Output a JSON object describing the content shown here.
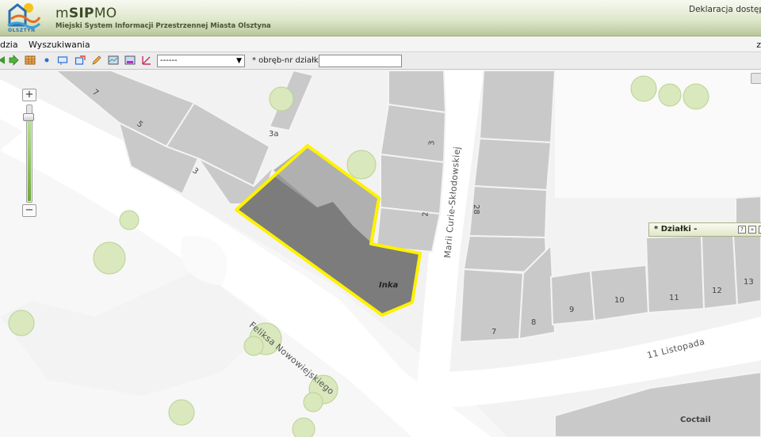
{
  "header": {
    "logo_caption": "OLSZTYN",
    "title_prefix": "m",
    "title_bold": "SIP",
    "title_suffix": "MO",
    "subtitle": "Miejski System Informacji Przestrzennej Miasta Olsztyna",
    "access_link": "Deklaracja dostęp"
  },
  "menu": {
    "items": [
      "dzia",
      "Wyszukiwania"
    ],
    "right_fragment": "z"
  },
  "toolbar": {
    "icons": [
      "pan-arrow-icon",
      "forward-icon",
      "table-icon",
      "point-icon",
      "rectangle-select-icon",
      "edit-select-icon",
      "pencil-icon",
      "map-print-icon",
      "map-export-icon",
      "measure-icon"
    ],
    "layer_select_value": "------",
    "parcel_label": "* obręb-nr działki:",
    "parcel_value": ""
  },
  "map": {
    "streets": {
      "nowowiejskiego": "Feliksa Nowowiejskiego",
      "sklodowskiej": "Marii Curie-Skłodowskiej",
      "listopada": "11 Listopada"
    },
    "house_numbers": [
      "7",
      "5",
      "3",
      "3a",
      "3",
      "2",
      "28",
      "7",
      "8",
      "9",
      "10",
      "11",
      "12",
      "13"
    ],
    "buildings": {
      "inka": "Inka",
      "coctail": "Coctail"
    },
    "selected_parcel_color": "#fff200"
  },
  "zoom": {
    "level_fraction": 0.9
  },
  "dzialki_panel": {
    "title": "* Działki -",
    "buttons": [
      "?",
      "«",
      "×"
    ]
  }
}
